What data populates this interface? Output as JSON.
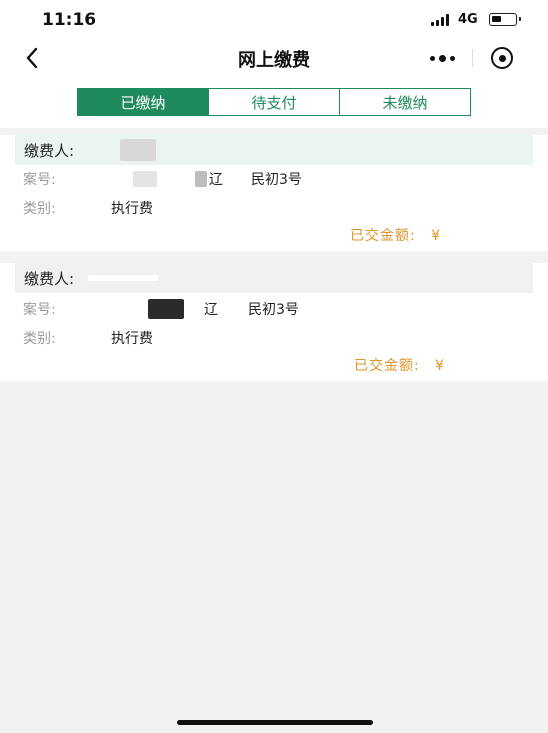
{
  "status_bar": {
    "time": "11:16",
    "network": "4G"
  },
  "nav": {
    "title": "网上缴费"
  },
  "tabs": [
    {
      "label": "已缴纳",
      "active": true
    },
    {
      "label": "待支付",
      "active": false
    },
    {
      "label": "未缴纳",
      "active": false
    }
  ],
  "records": [
    {
      "payer_label": "缴费人:",
      "case_label": "案号:",
      "case_suffix_1": "辽",
      "case_suffix_2": "民初3号",
      "category_label": "类别:",
      "category_value": "执行费",
      "amount_label": "已交金额:",
      "amount_currency": "¥"
    },
    {
      "payer_label": "缴费人:",
      "case_label": "案号:",
      "case_suffix_1": "辽",
      "case_suffix_2": "民初3号",
      "category_label": "类别:",
      "category_value": "执行费",
      "amount_label": "已交金额:",
      "amount_currency": "¥"
    }
  ],
  "colors": {
    "accent": "#1f8a5c",
    "amount": "#e0952a",
    "header_bg": "#eaf5f1"
  }
}
